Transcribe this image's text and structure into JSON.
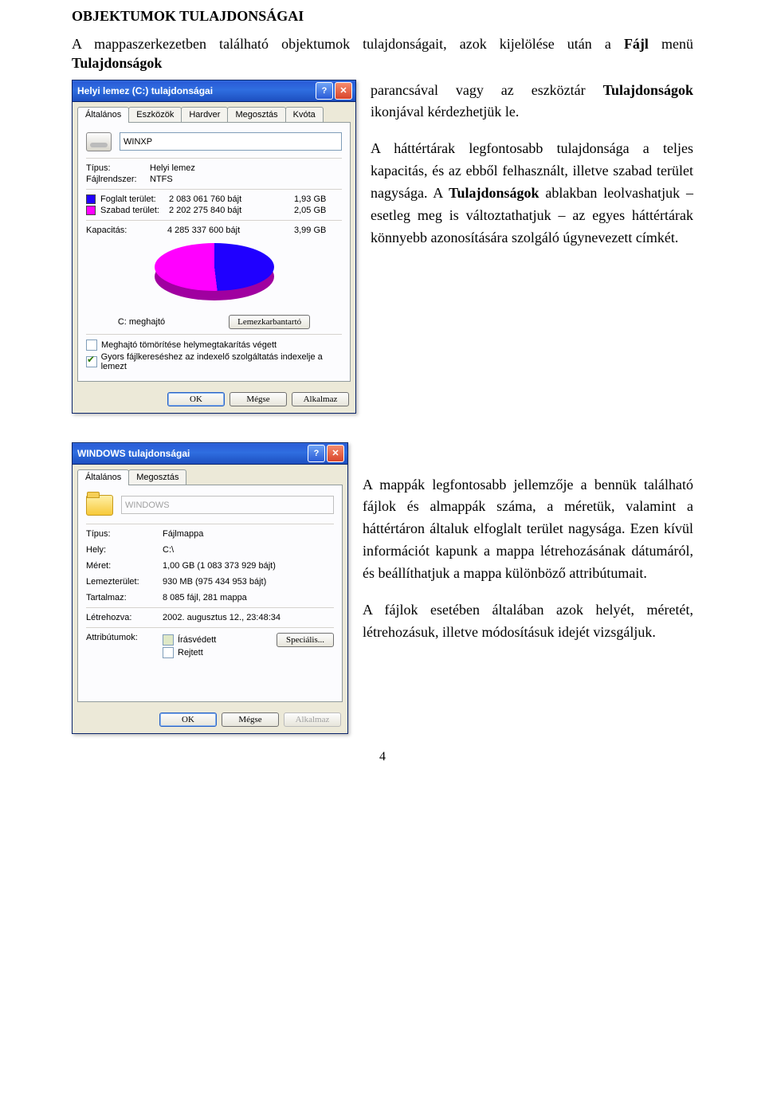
{
  "doc": {
    "title": "OBJEKTUMOK TULAJDONSÁGAI",
    "intro_pre": "A mappaszerkezetben található objektumok tulajdonságait, azok kijelölése után a ",
    "intro_menu": "Fájl",
    "intro_mid": " menü ",
    "intro_cmd": "Tulajdonságok",
    "para1_a": "parancsával vagy az eszköztár ",
    "para1_b": "Tulajdonságok",
    "para1_c": " ikonjával kérdezhetjük le.",
    "para2_a": "A háttértárak legfontosabb tulajdonsága a teljes kapacitás, és az ebből felhasznált, illetve szabad terület nagysága. A ",
    "para2_b": "Tulajdonságok",
    "para2_c": " ablakban leolvashatjuk – esetleg meg is változtathatjuk – az egyes háttértárak könnyebb azonosítására szolgáló úgynevezett címkét.",
    "para3": "A mappák legfontosabb jellemzője a bennük található fájlok és almappák száma, a méretük, valamint a háttértáron általuk elfoglalt terület nagysága. Ezen kívül információt kapunk a mappa létrehozásának dátumáról, és beállíthatjuk a mappa különböző attribútumait.",
    "para4": "A fájlok esetében általában azok helyét, méretét, létrehozásuk, illetve módosításuk idejét vizsgáljuk.",
    "page_number": "4"
  },
  "win1": {
    "title": "Helyi lemez (C:) tulajdonságai",
    "tabs": [
      "Általános",
      "Eszközök",
      "Hardver",
      "Megosztás",
      "Kvóta"
    ],
    "label_value": "WINXP",
    "type_label": "Típus:",
    "type_value": "Helyi lemez",
    "fs_label": "Fájlrendszer:",
    "fs_value": "NTFS",
    "used_label": "Foglalt terület:",
    "used_bytes": "2 083 061 760 bájt",
    "used_gb": "1,93 GB",
    "free_label": "Szabad terület:",
    "free_bytes": "2 202 275 840 bájt",
    "free_gb": "2,05 GB",
    "cap_label": "Kapacitás:",
    "cap_bytes": "4 285 337 600 bájt",
    "cap_gb": "3,99 GB",
    "drive_caption": "C: meghajtó",
    "cleanup_btn": "Lemezkarbantartó",
    "compress_chk": "Meghajtó tömörítése helymegtakarítás végett",
    "index_chk": "Gyors fájlkereséshez az indexelő szolgáltatás indexelje a lemezt",
    "ok": "OK",
    "cancel": "Mégse",
    "apply": "Alkalmaz"
  },
  "win2": {
    "title": "WINDOWS tulajdonságai",
    "tabs": [
      "Általános",
      "Megosztás"
    ],
    "name_value": "WINDOWS",
    "type_label": "Típus:",
    "type_value": "Fájlmappa",
    "loc_label": "Hely:",
    "loc_value": "C:\\",
    "size_label": "Méret:",
    "size_value": "1,00 GB (1 083 373 929 bájt)",
    "disk_label": "Lemezterület:",
    "disk_value": "930 MB (975 434 953 bájt)",
    "contains_label": "Tartalmaz:",
    "contains_value": "8 085 fájl, 281 mappa",
    "created_label": "Létrehozva:",
    "created_value": "2002. augusztus 12., 23:48:34",
    "attr_label": "Attribútumok:",
    "attr_ro": "Írásvédett",
    "attr_hidden": "Rejtett",
    "advanced_btn": "Speciális...",
    "ok": "OK",
    "cancel": "Mégse",
    "apply": "Alkalmaz"
  }
}
